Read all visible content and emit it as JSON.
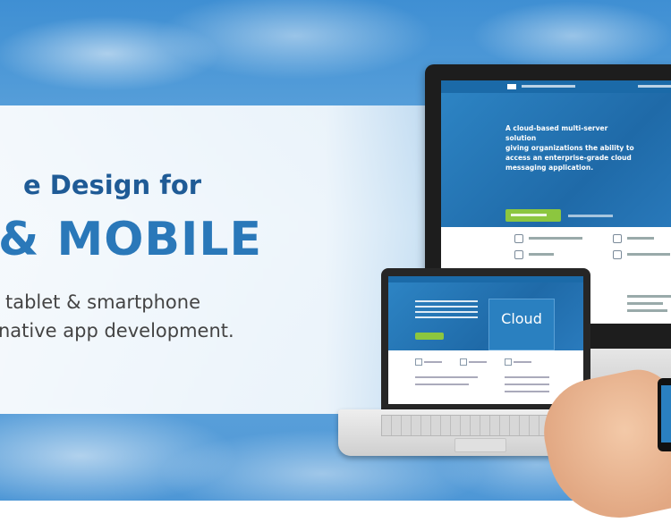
{
  "banner": {
    "headline_line1": "e Design for",
    "headline_line2": "& MOBILE",
    "sub_line1": "tablet & smartphone",
    "sub_line2": "native app development."
  },
  "monitor": {
    "hero_text": "A cloud-based multi-server solution\ngiving organizations the ability to\naccess an enterprise-grade cloud\nmessaging application."
  },
  "laptop": {
    "cloud_label": "Cloud"
  },
  "colors": {
    "headline_dark": "#1f5b96",
    "headline_light": "#2a78b9",
    "site_blue": "#1b6aa8",
    "signup_green": "#8cc63f"
  }
}
